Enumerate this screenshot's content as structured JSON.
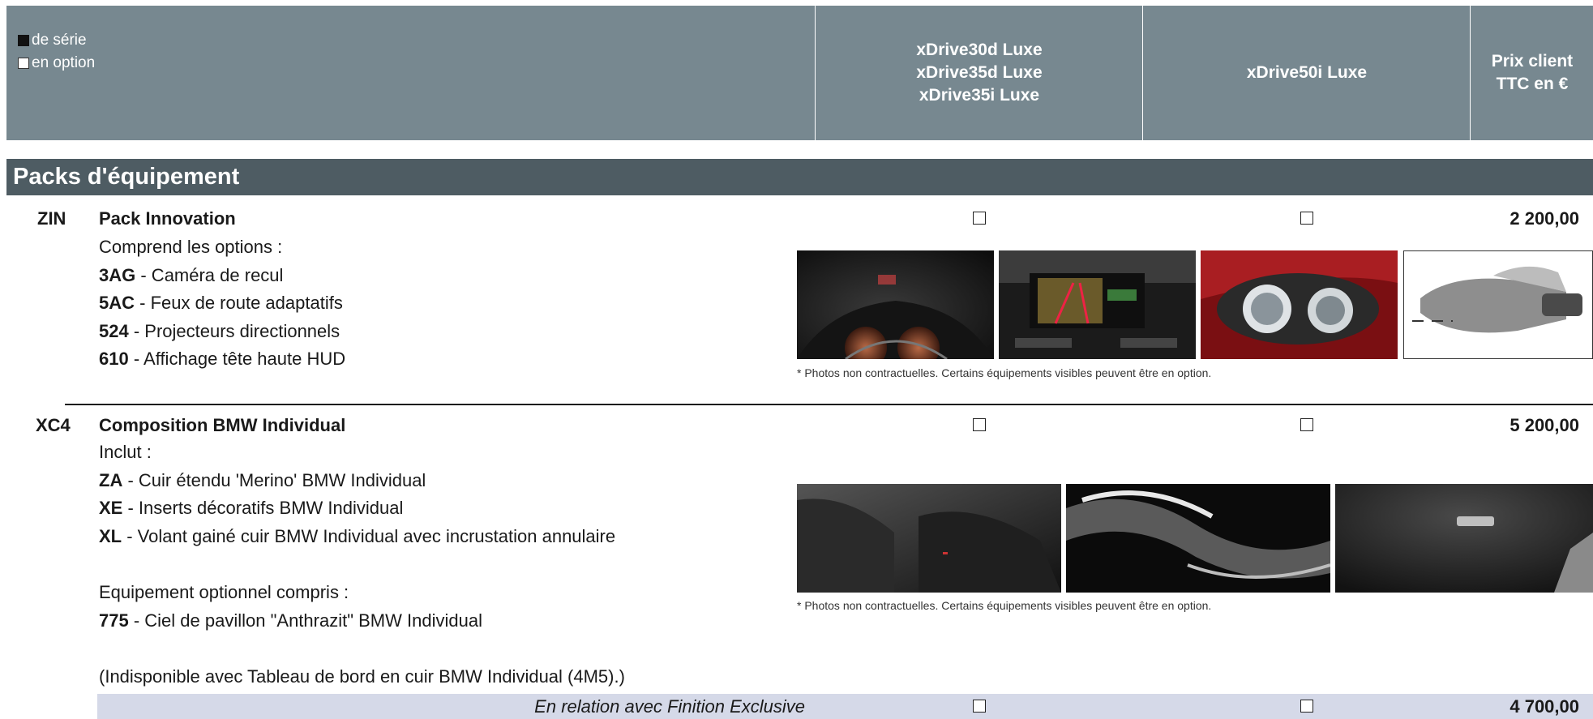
{
  "header": {
    "legend_standard": "de série",
    "legend_option": "en option",
    "col1_lines": [
      "xDrive30d Luxe",
      "xDrive35d Luxe",
      "xDrive35i Luxe"
    ],
    "col2": "xDrive50i Luxe",
    "col3_lines": [
      "Prix client",
      "TTC en €"
    ]
  },
  "section": {
    "title": "Packs d'équipement"
  },
  "packs": [
    {
      "code": "ZIN",
      "name": "Pack Innovation",
      "lines": [
        {
          "prefix": "",
          "text": "Comprend les options :"
        },
        {
          "prefix": "3AG",
          "text": " - Caméra de recul"
        },
        {
          "prefix": "5AC",
          "text": " - Feux de route adaptatifs"
        },
        {
          "prefix": "524",
          "text": " - Projecteurs directionnels"
        },
        {
          "prefix": "610",
          "text": " - Affichage tête haute HUD"
        }
      ],
      "price": "2 200,00",
      "caption": "* Photos non contractuelles. Certains équipements visibles peuvent être en option."
    },
    {
      "code": "XC4",
      "name": "Composition BMW Individual",
      "lines": [
        {
          "prefix": "",
          "text": "Inclut :"
        },
        {
          "prefix": "ZA",
          "text": " - Cuir étendu 'Merino' BMW Individual"
        },
        {
          "prefix": "XE",
          "text": " - Inserts décoratifs BMW Individual"
        },
        {
          "prefix": "XL",
          "text": " - Volant gainé cuir BMW Individual avec incrustation annulaire"
        },
        {
          "prefix": "",
          "text": ""
        },
        {
          "prefix": "",
          "text": "Equipement optionnel compris :"
        },
        {
          "prefix": "775",
          "text": " - Ciel de pavillon \"Anthrazit\" BMW Individual"
        },
        {
          "prefix": "",
          "text": ""
        },
        {
          "prefix": "",
          "text": "(Indisponible avec Tableau de bord en cuir BMW Individual (4M5).)"
        }
      ],
      "price": "5 200,00",
      "caption": "* Photos non contractuelles. Certains équipements visibles peuvent être en option.",
      "relation": {
        "text": "En relation avec Finition Exclusive",
        "price": "4 700,00"
      }
    }
  ]
}
